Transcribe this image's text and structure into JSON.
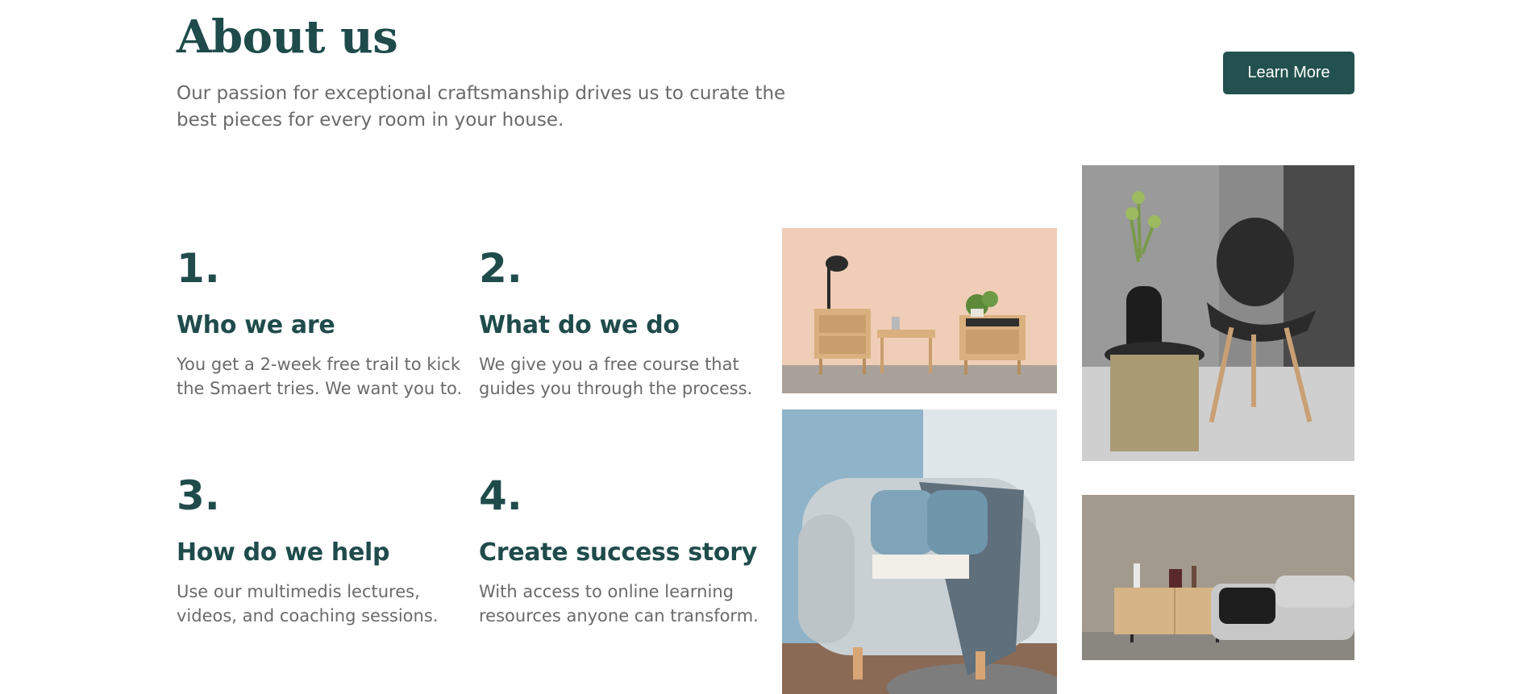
{
  "header": {
    "title": "About us",
    "intro": "Our passion for exceptional craftsmanship drives us to curate the best pieces for every room in your house.",
    "cta_label": "Learn More"
  },
  "steps": [
    {
      "number": "1.",
      "title": "Who we are",
      "text": "You get a 2-week free trail to kick the Smaert tries. We want you to."
    },
    {
      "number": "2.",
      "title": "What do we do",
      "text": "We give you a free course that guides you through the process."
    },
    {
      "number": "3.",
      "title": "How do we help",
      "text": "Use our multimedis lectures, videos, and coaching sessions."
    },
    {
      "number": "4.",
      "title": "Create success story",
      "text": "With access to online learning resources anyone can transform."
    }
  ],
  "gallery": {
    "images": [
      "bedside-tables-photo",
      "armchair-photo",
      "black-chair-photo",
      "sofa-sideboard-photo"
    ]
  },
  "colors": {
    "brand": "#1f4b4b",
    "button": "#22514f",
    "body_text": "#6a6a6a",
    "background": "#ffffff"
  }
}
